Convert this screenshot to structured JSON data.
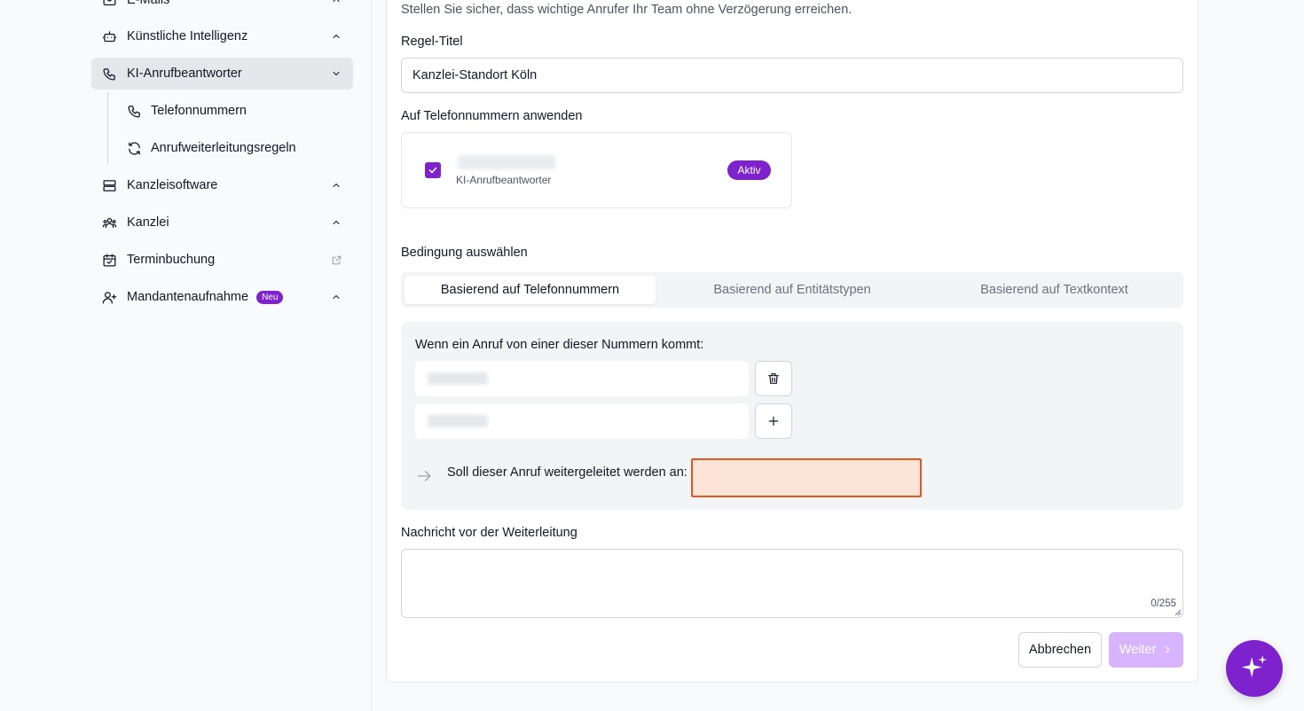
{
  "sidebar": {
    "items": [
      {
        "label": "E-Mails"
      },
      {
        "label": "Künstliche Intelligenz"
      },
      {
        "label": "KI-Anrufbeantworter"
      },
      {
        "label": "Kanzleisoftware"
      },
      {
        "label": "Kanzlei"
      },
      {
        "label": "Terminbuchung"
      },
      {
        "label": "Mandantenaufnahme",
        "badge": "Neu"
      }
    ],
    "subitems": [
      {
        "label": "Telefonnummern"
      },
      {
        "label": "Anrufweiterleitungsregeln"
      }
    ]
  },
  "form": {
    "subtitle": "Stellen Sie sicher, dass wichtige Anrufer Ihr Team ohne Verzögerung erreichen.",
    "title_label": "Regel-Titel",
    "title_value": "Kanzlei-Standort Köln",
    "apply_label": "Auf Telefonnummern anwenden",
    "phone": {
      "subtitle": "KI-Anrufbeantworter",
      "status": "Aktiv"
    },
    "condition_label": "Bedingung auswählen",
    "tabs": [
      {
        "label": "Basierend auf Telefonnummern"
      },
      {
        "label": "Basierend auf Entitätstypen"
      },
      {
        "label": "Basierend auf Textkontext"
      }
    ],
    "when_label": "Wenn ein Anruf von einer dieser Nummern kommt:",
    "forward_label": "Soll dieser Anruf weitergeleitet werden an:",
    "forward_value": "",
    "message_label": "Nachricht vor der Weiterleitung",
    "message_value": "",
    "counter": "0/255",
    "cancel_label": "Abbrechen",
    "next_label": "Weiter"
  },
  "colors": {
    "accent": "#7e22ce",
    "accent_disabled": "#d8b4fe",
    "error_border": "#e0581c",
    "error_fill": "#fde4d8"
  }
}
